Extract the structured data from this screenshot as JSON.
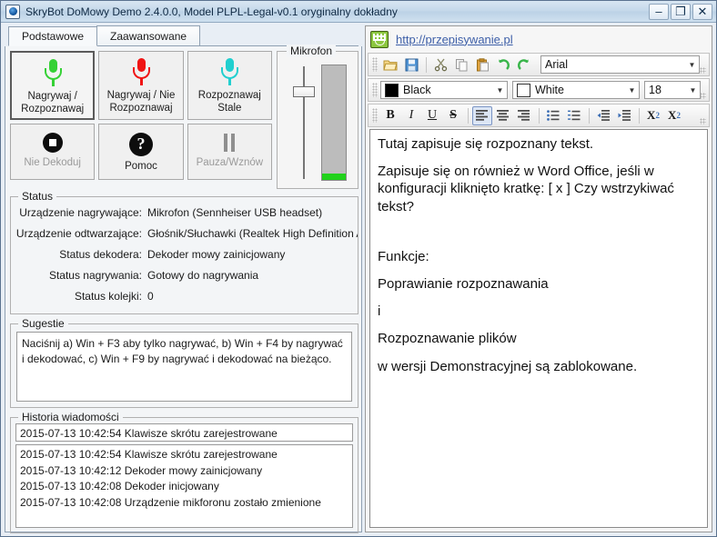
{
  "window": {
    "title": "SkryBot DoMowy Demo 2.4.0.0, Model PLPL-Legal-v0.1 oryginalny dokładny",
    "icon": "app-icon",
    "minimize": "–",
    "maximize": "❐",
    "close": "✕"
  },
  "tabs": [
    {
      "label": "Podstawowe",
      "active": true
    },
    {
      "label": "Zaawansowane",
      "active": false
    }
  ],
  "buttons": [
    {
      "label": "Nagrywaj / Rozpoznawaj",
      "icon": "microphone-icon",
      "color": "#35d135",
      "state": "selected"
    },
    {
      "label": "Nagrywaj / Nie Rozpoznawaj",
      "icon": "microphone-icon",
      "color": "#f01414",
      "state": "normal"
    },
    {
      "label": "Rozpoznawaj Stale",
      "icon": "microphone-icon",
      "color": "#21cfcf",
      "state": "normal"
    },
    {
      "label": "Nie Dekoduj",
      "icon": "stop-icon",
      "color": "#0d0d0d",
      "state": "disabled"
    },
    {
      "label": "Pomoc",
      "icon": "help-icon",
      "color": "#0d0d0d",
      "state": "normal"
    },
    {
      "label": "Pauza/Wznów",
      "icon": "pause-icon",
      "color": "#8f8f8f",
      "state": "disabled"
    }
  ],
  "microphone": {
    "title": "Mikrofon",
    "slider_value": 82,
    "level_percent": 6,
    "level_color": "#21d21b"
  },
  "status": {
    "title": "Status",
    "rows": [
      {
        "key": "Urządzenie nagrywające:",
        "value": "Mikrofon (Sennheiser USB headset)"
      },
      {
        "key": "Urządzenie odtwarzające:",
        "value": "Głośnik/Słuchawki (Realtek High Definition A"
      },
      {
        "key": "Status dekodera:",
        "value": "Dekoder mowy zainicjowany"
      },
      {
        "key": "Status nagrywania:",
        "value": "Gotowy do nagrywania"
      },
      {
        "key": "Status kolejki:",
        "value": "0"
      }
    ]
  },
  "sugestie": {
    "title": "Sugestie",
    "text": "Naciśnij a) Win + F3 aby tylko nagrywać, b) Win + F4 by nagrywać i dekodować, c) Win + F9 by nagrywać i dekodować na bieżąco."
  },
  "historia": {
    "title": "Historia wiadomości",
    "current": "2015-07-13 10:42:54 Klawisze skrótu zarejestrowane",
    "rows": [
      "2015-07-13 10:42:54 Klawisze skrótu zarejestrowane",
      "2015-07-13 10:42:12 Dekoder mowy zainicjowany",
      "2015-07-13 10:42:08 Dekoder inicjowany",
      "2015-07-13 10:42:08 Urządzenie mikforonu zostało zmienione"
    ]
  },
  "editor": {
    "url": "http://przepisywanie.pl",
    "url_icon": "smiley-grid-icon",
    "toolbar_file": [
      {
        "name": "open-icon",
        "glyph": "📂"
      },
      {
        "name": "save-icon",
        "glyph": "💾"
      },
      {
        "name": "cut-icon",
        "glyph": "✂"
      },
      {
        "name": "copy-icon",
        "glyph": "❐"
      },
      {
        "name": "paste-icon",
        "glyph": "📋"
      },
      {
        "name": "undo-icon",
        "glyph": "↩"
      },
      {
        "name": "redo-icon",
        "glyph": "↪"
      }
    ],
    "font_name": "Arial",
    "fore_color_label": "Black",
    "fore_color_hex": "#000000",
    "back_color_label": "White",
    "back_color_hex": "#ffffff",
    "font_size": "18",
    "format_buttons": [
      {
        "name": "bold-icon",
        "glyph": "B",
        "pressed": false
      },
      {
        "name": "italic-icon",
        "glyph": "I",
        "pressed": false
      },
      {
        "name": "underline-icon",
        "glyph": "U",
        "pressed": false
      },
      {
        "name": "strikethrough-icon",
        "glyph": "S",
        "pressed": false
      },
      {
        "name": "align-left-icon",
        "glyph": "≡",
        "pressed": true
      },
      {
        "name": "align-center-icon",
        "glyph": "≡",
        "pressed": false
      },
      {
        "name": "align-right-icon",
        "glyph": "≡",
        "pressed": false
      },
      {
        "name": "bullet-list-icon",
        "glyph": "☰",
        "pressed": false
      },
      {
        "name": "numbered-list-icon",
        "glyph": "☰",
        "pressed": false
      },
      {
        "name": "outdent-icon",
        "glyph": "⇥",
        "pressed": false
      },
      {
        "name": "indent-icon",
        "glyph": "⇤",
        "pressed": false
      },
      {
        "name": "subscript-icon",
        "glyph": "X₂",
        "pressed": false
      },
      {
        "name": "superscript-icon",
        "glyph": "X²",
        "pressed": false
      }
    ],
    "paragraphs": [
      "Tutaj zapisuje się rozpoznany tekst.",
      "Zapisuje się on również w Word Office, jeśli w konfiguracji kliknięto kratkę: [ x ] Czy wstrzykiwać tekst?",
      "",
      "Funkcje:",
      "Poprawianie rozpoznawania",
      "i",
      "Rozpoznawanie plików",
      "w wersji Demonstracyjnej są zablokowane."
    ]
  }
}
